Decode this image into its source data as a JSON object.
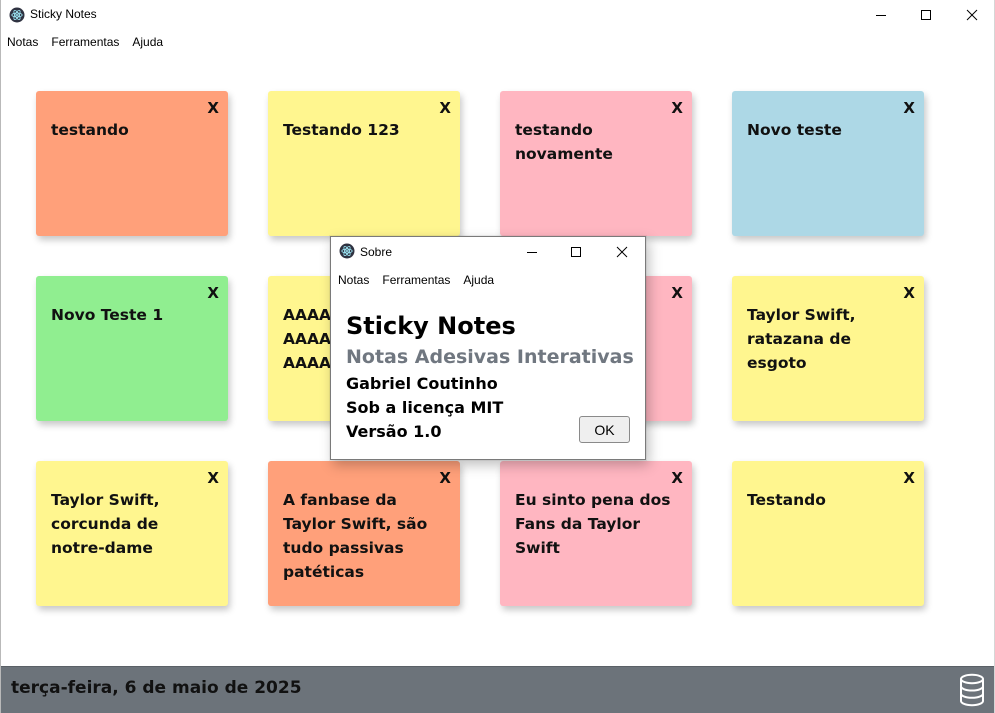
{
  "window": {
    "title": "Sticky Notes",
    "icon": "electron-atom-icon",
    "controls": [
      "minimize-icon",
      "maximize-icon",
      "close-icon"
    ]
  },
  "menu": {
    "items": [
      "Notas",
      "Ferramentas",
      "Ajuda"
    ]
  },
  "notes": [
    {
      "text": "testando",
      "close": "X",
      "color": "#ffa07a"
    },
    {
      "text": "Testando 123",
      "close": "X",
      "color": "#fff68f"
    },
    {
      "text": "testando novamente",
      "close": "X",
      "color": "#ffb6c1"
    },
    {
      "text": "Novo teste",
      "close": "X",
      "color": "#add8e6"
    },
    {
      "text": "Novo Teste 1",
      "close": "X",
      "color": "#90ee90"
    },
    {
      "text": "AAAAAAAAAAAAAAAAAAAAAAAAAAAAAA",
      "close": "X",
      "color": "#fff68f"
    },
    {
      "text": "",
      "close": "X",
      "color": "#ffb6c1"
    },
    {
      "text": "Taylor Swift, ratazana de esgoto",
      "close": "X",
      "color": "#fff68f"
    },
    {
      "text": "Taylor Swift, corcunda de notre-dame",
      "close": "X",
      "color": "#fff68f"
    },
    {
      "text": "A fanbase da Taylor Swift, são tudo passivas patéticas",
      "close": "X",
      "color": "#ffa07a"
    },
    {
      "text": "Eu sinto pena dos Fans da Taylor Swift",
      "close": "X",
      "color": "#ffb6c1"
    },
    {
      "text": "Testando",
      "close": "X",
      "color": "#fff68f"
    }
  ],
  "statusbar": {
    "date": "terça-feira, 6 de maio de 2025",
    "icon": "database-icon",
    "background": "#6c737a"
  },
  "about_dialog": {
    "title": "Sobre",
    "menu": [
      "Notas",
      "Ferramentas",
      "Ajuda"
    ],
    "heading": "Sticky Notes",
    "subtitle": "Notas Adesivas Interativas",
    "author": "Gabriel Coutinho",
    "license": "Sob a licença MIT",
    "version": "Versão 1.0",
    "ok_label": "OK"
  }
}
